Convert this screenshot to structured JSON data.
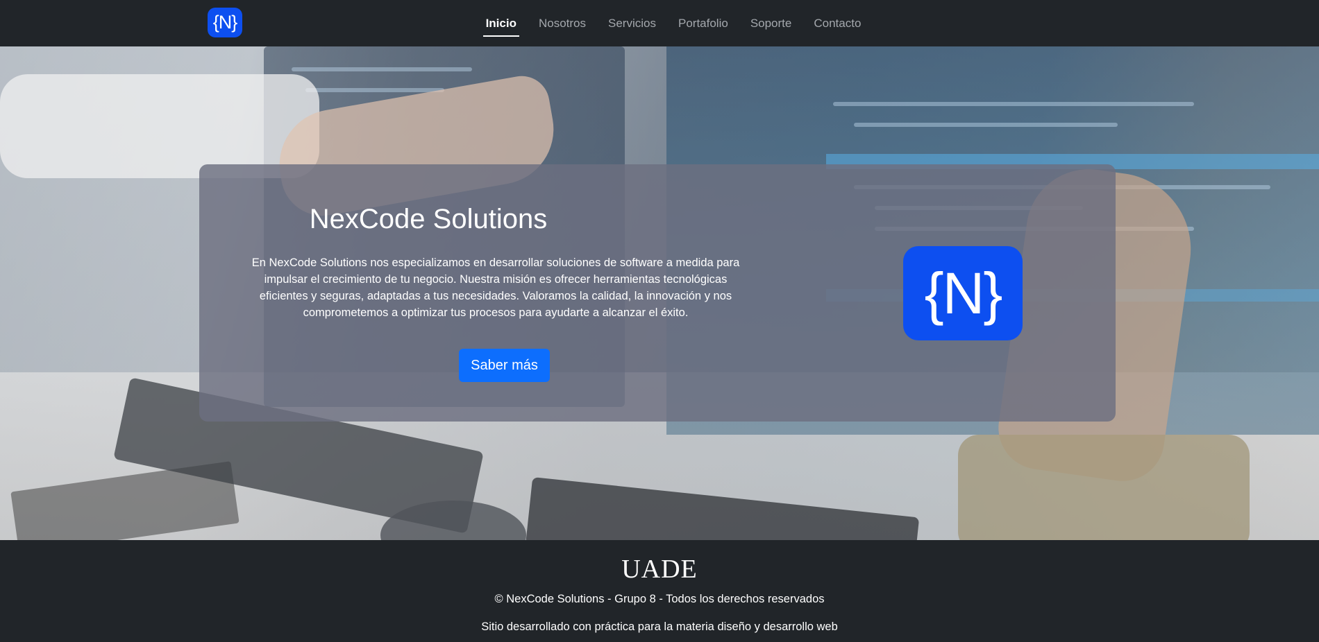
{
  "navbar": {
    "logo_text": "{N}",
    "items": [
      {
        "label": "Inicio",
        "active": true
      },
      {
        "label": "Nosotros",
        "active": false
      },
      {
        "label": "Servicios",
        "active": false
      },
      {
        "label": "Portafolio",
        "active": false
      },
      {
        "label": "Soporte",
        "active": false
      },
      {
        "label": "Contacto",
        "active": false
      }
    ]
  },
  "hero": {
    "title": "NexCode Solutions",
    "description": "En NexCode Solutions nos especializamos en desarrollar soluciones de software a medida para impulsar el crecimiento de tu negocio. Nuestra misión es ofrecer herramientas tecnológicas eficientes y seguras, adaptadas a tus necesidades. Valoramos la calidad, la innovación y nos comprometemos a optimizar tus procesos para ayudarte a alcanzar el éxito.",
    "button_label": "Saber más",
    "logo_text": "{N}"
  },
  "footer": {
    "logo_text": "UADE",
    "copyright": "© NexCode Solutions - Grupo 8 - Todos los derechos reservados",
    "credit": "Sitio desarrollado con práctica para la materia diseño y desarrollo web"
  },
  "colors": {
    "navbar_bg": "#212529",
    "brand_blue": "#0d4ff0",
    "button_blue": "#0d6efd",
    "card_overlay": "#6c6f80",
    "nav_inactive": "#a4a8ad"
  },
  "icons": {
    "nav_logo": "nexcode-logo-icon",
    "hero_logo": "nexcode-logo-icon"
  }
}
